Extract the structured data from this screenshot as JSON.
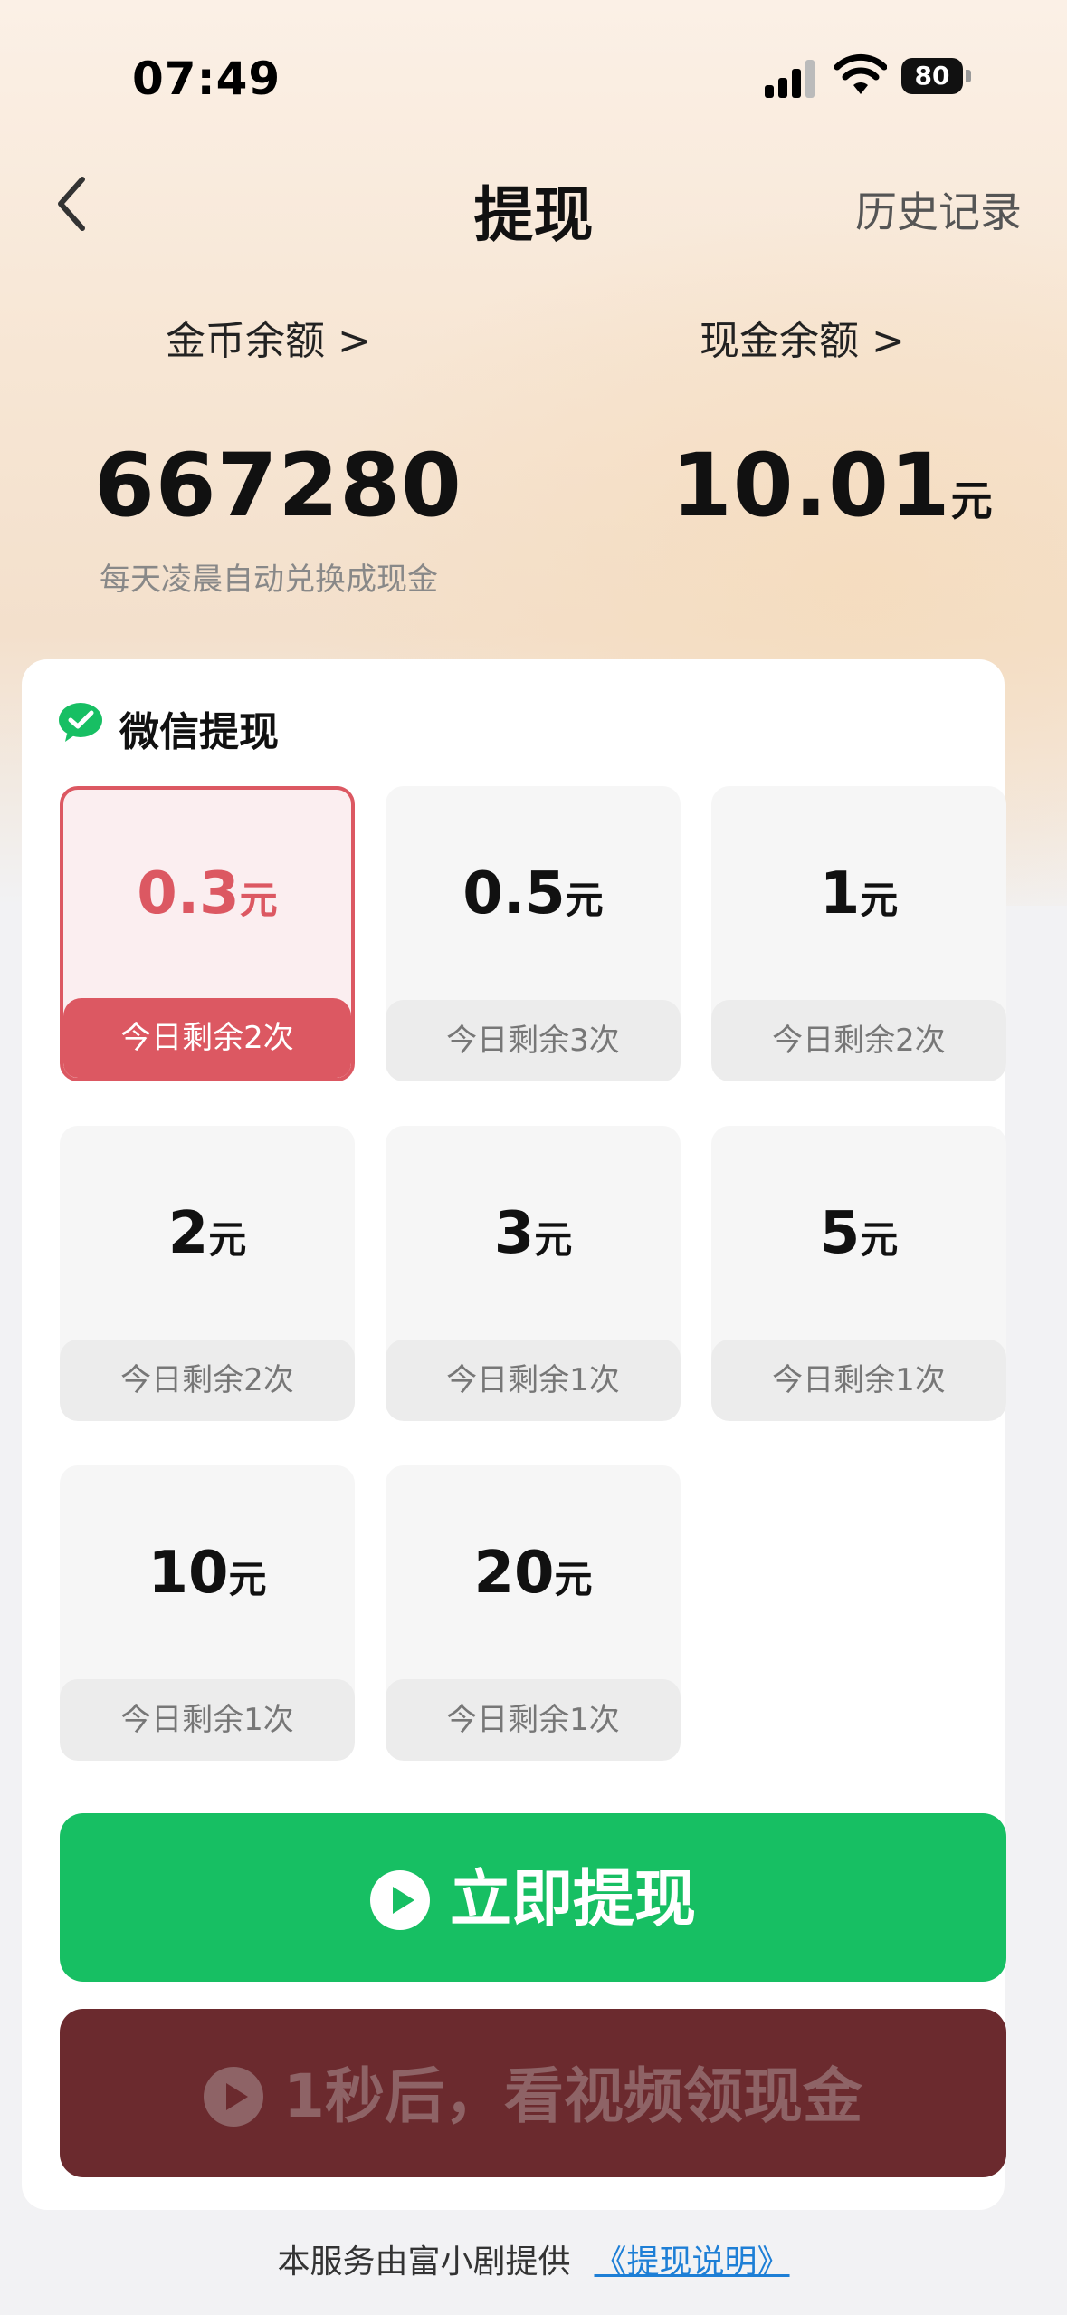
{
  "status_bar": {
    "time": "07:49",
    "battery": "80"
  },
  "nav": {
    "title": "提现",
    "history": "历史记录"
  },
  "balances": {
    "coin_label": "金币余额 >",
    "coin_value": "667280",
    "coin_note": "每天凌晨自动兑换成现金",
    "cash_label": "现金余额 >",
    "cash_value": "10.01",
    "cash_unit": "元"
  },
  "wechat": {
    "title": "微信提现"
  },
  "options": [
    {
      "amount": "0.3",
      "unit": "元",
      "remaining": "今日剩余2次",
      "selected": true
    },
    {
      "amount": "0.5",
      "unit": "元",
      "remaining": "今日剩余3次",
      "selected": false
    },
    {
      "amount": "1",
      "unit": "元",
      "remaining": "今日剩余2次",
      "selected": false
    },
    {
      "amount": "2",
      "unit": "元",
      "remaining": "今日剩余2次",
      "selected": false
    },
    {
      "amount": "3",
      "unit": "元",
      "remaining": "今日剩余1次",
      "selected": false
    },
    {
      "amount": "5",
      "unit": "元",
      "remaining": "今日剩余1次",
      "selected": false
    },
    {
      "amount": "10",
      "unit": "元",
      "remaining": "今日剩余1次",
      "selected": false
    },
    {
      "amount": "20",
      "unit": "元",
      "remaining": "今日剩余1次",
      "selected": false
    }
  ],
  "buttons": {
    "withdraw": "立即提现",
    "video": "1秒后，看视频领现金"
  },
  "footer": {
    "text": "本服务由富小剧提供",
    "link": "《提现说明》"
  },
  "colors": {
    "accent_red": "#dc5862",
    "wechat_green": "#17bf63",
    "dark_button": "#6b2a2e"
  }
}
